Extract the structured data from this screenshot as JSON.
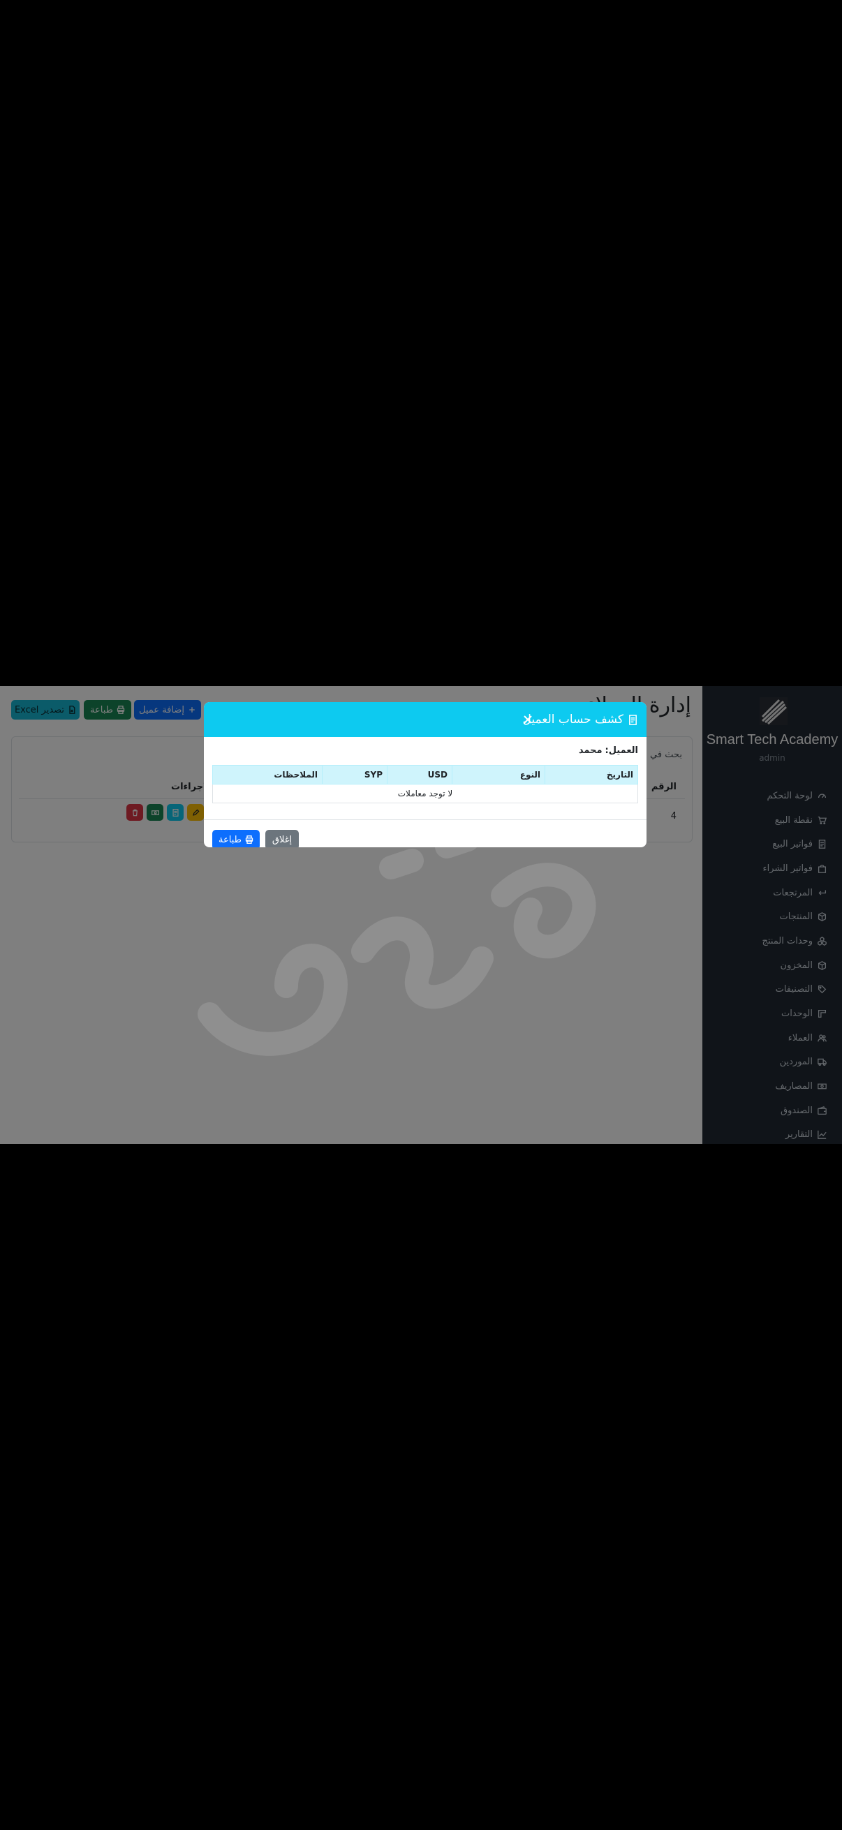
{
  "sidebar": {
    "brand": "Smart Tech Academy",
    "user": "admin",
    "items": [
      {
        "label": "لوحة التحكم",
        "icon": "dashboard-icon"
      },
      {
        "label": "نقطة البيع",
        "icon": "cart-icon"
      },
      {
        "label": "فواتير البيع",
        "icon": "receipt-icon"
      },
      {
        "label": "فواتير الشراء",
        "icon": "bag-icon"
      },
      {
        "label": "المرتجعات",
        "icon": "return-icon"
      },
      {
        "label": "المنتجات",
        "icon": "box-icon"
      },
      {
        "label": "وحدات المنتج",
        "icon": "boxes-icon"
      },
      {
        "label": "المخزون",
        "icon": "box-icon"
      },
      {
        "label": "التصنيفات",
        "icon": "tags-icon"
      },
      {
        "label": "الوحدات",
        "icon": "rulers-icon"
      },
      {
        "label": "العملاء",
        "icon": "people-icon"
      },
      {
        "label": "الموردين",
        "icon": "truck-icon"
      },
      {
        "label": "المصاريف",
        "icon": "cash-icon"
      },
      {
        "label": "الصندوق",
        "icon": "wallet-icon"
      },
      {
        "label": "التقارير",
        "icon": "graph-icon"
      }
    ]
  },
  "page": {
    "title": "إدارة العملاء",
    "search_label": "بحث في",
    "buttons": {
      "excel": "تصدير Excel",
      "print": "طباعة",
      "add": "إضافة عميل"
    },
    "table": {
      "headers": {
        "number": "الرقم",
        "actions": "الإجراءات"
      },
      "rows": [
        {
          "number": "4"
        }
      ]
    }
  },
  "modal": {
    "title": "كشف حساب العميل",
    "client_label": "العميل:",
    "client_name": "محمد",
    "table_headers": [
      "التاريخ",
      "النوع",
      "USD",
      "SYP",
      "الملاحظات"
    ],
    "empty_text": "لا توجد معاملات",
    "close_label": "إغلاق",
    "print_label": "طباعة"
  },
  "colors": {
    "sidebar_bg": "#212832",
    "modal_header": "#0dcaf0",
    "primary": "#0d6efd",
    "success": "#198754",
    "danger": "#dc3545",
    "warning": "#ffc107",
    "secondary": "#6c757d"
  }
}
